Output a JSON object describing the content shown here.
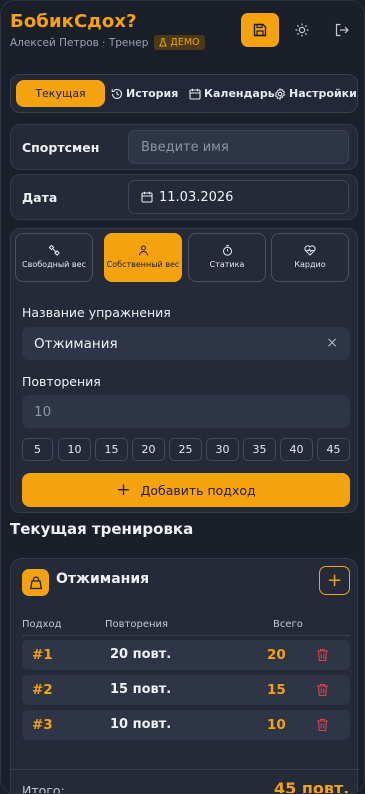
{
  "header": {
    "title": "БобикСдох?",
    "user": "Алексей Петров · Тренер",
    "badge": "ДЕМО"
  },
  "tabs": [
    {
      "label": "Текущая",
      "icon": "none",
      "active": true
    },
    {
      "label": "История",
      "icon": "history-icon"
    },
    {
      "label": "Календарь",
      "icon": "calendar-icon"
    },
    {
      "label": "Настройки",
      "icon": "gear-icon"
    }
  ],
  "athlete": {
    "label": "Спортсмен",
    "placeholder": "Введите имя"
  },
  "date": {
    "label": "Дата",
    "value": "11.03.2026"
  },
  "exercise_types": [
    {
      "label": "Свободный вес",
      "icon": "dumbbell-icon"
    },
    {
      "label": "Собственный вес",
      "icon": "person-icon",
      "active": true
    },
    {
      "label": "Статика",
      "icon": "stopwatch-icon"
    },
    {
      "label": "Кардио",
      "icon": "heart-pulse-icon"
    }
  ],
  "exercise_name": {
    "label": "Название упражнения",
    "value": "Отжимания",
    "clear": "×"
  },
  "reps": {
    "label": "Повторения",
    "placeholder": "10"
  },
  "quick_reps": [
    "5",
    "10",
    "15",
    "20",
    "25",
    "30",
    "35",
    "40",
    "45"
  ],
  "add_set": {
    "icon": "+",
    "label": "Добавить подход"
  },
  "current_workout": {
    "title": "Текущая тренировка",
    "exercise": "Отжимания",
    "add": "+",
    "columns": [
      "Подход",
      "Повторения",
      "Всего"
    ],
    "sets": [
      {
        "num": "#1",
        "reps": "20 повт.",
        "total": "20"
      },
      {
        "num": "#2",
        "reps": "15 повт.",
        "total": "15"
      },
      {
        "num": "#3",
        "reps": "10 повт.",
        "total": "10"
      }
    ],
    "total_label": "Итого:",
    "total_value": "45 повт."
  },
  "colors": {
    "accent": "#f5a20f",
    "background": "#1b1f2a",
    "card": "#242a38",
    "delete": "#e0424a"
  }
}
